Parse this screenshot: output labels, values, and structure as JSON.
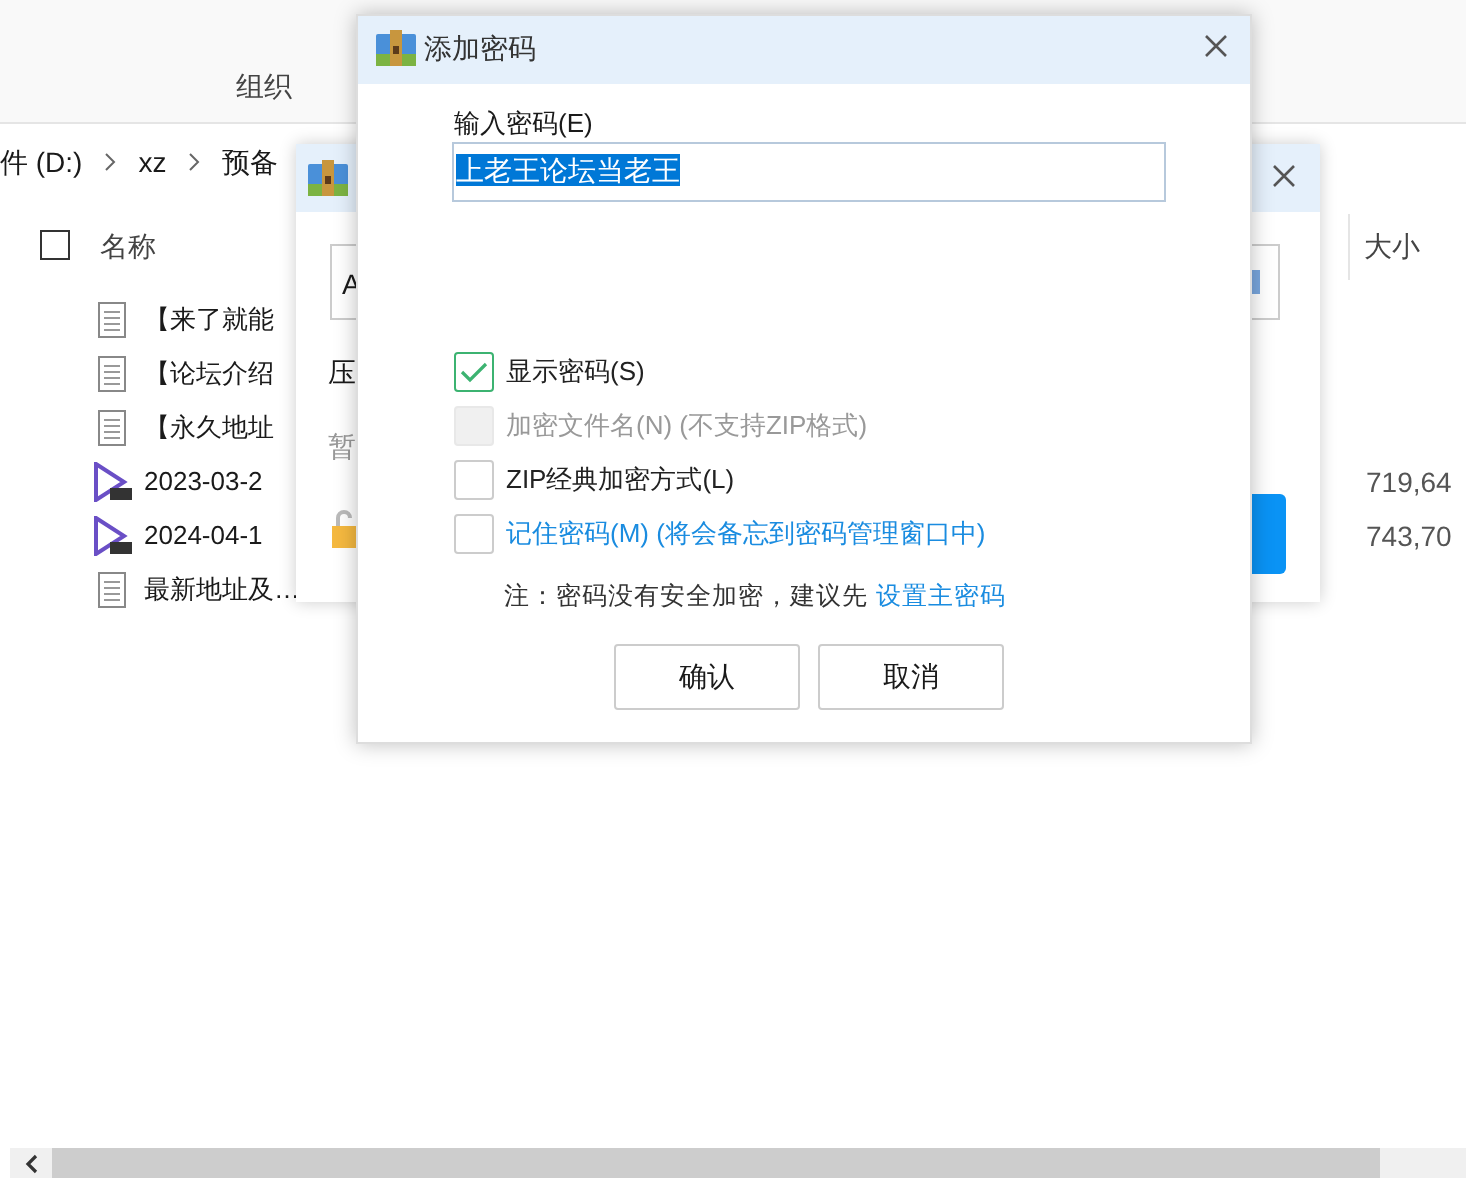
{
  "explorer": {
    "ribbon_group": "组织",
    "breadcrumb": [
      "件 (D:)",
      "xz",
      "预备"
    ],
    "select_all_checked": false,
    "columns": [
      "名称",
      "大小"
    ],
    "files": [
      {
        "kind": "doc",
        "name": "【来了就能"
      },
      {
        "kind": "doc",
        "name": "【论坛介绍"
      },
      {
        "kind": "doc",
        "name": "【永久地址"
      },
      {
        "kind": "video",
        "name": "2023-03-2",
        "size": "719,64"
      },
      {
        "kind": "video",
        "name": "2024-04-1",
        "size": "743,70"
      },
      {
        "kind": "doc",
        "name": "最新地址及…"
      }
    ]
  },
  "archive_dialog": {
    "field_value": "A",
    "labels": [
      "压",
      "暂"
    ]
  },
  "password_dialog": {
    "title": "添加密码",
    "input_label": "输入密码(E)",
    "password": "上老王论坛当老王",
    "options": [
      {
        "kind": "plain",
        "label": "显示密码(S)",
        "checked": true,
        "disabled": false
      },
      {
        "kind": "plain",
        "label": "加密文件名(N) (不支持ZIP格式)",
        "checked": false,
        "disabled": true
      },
      {
        "kind": "plain",
        "label": "ZIP经典加密方式(L)",
        "checked": false,
        "disabled": false
      },
      {
        "kind": "link",
        "label": "记住密码(M) (将会备忘到密码管理窗口中)",
        "checked": false,
        "disabled": false
      }
    ],
    "note": "注：密码没有安全加密，建议先",
    "note_link": "设置主密码",
    "buttons": [
      "确认",
      "取消"
    ]
  }
}
